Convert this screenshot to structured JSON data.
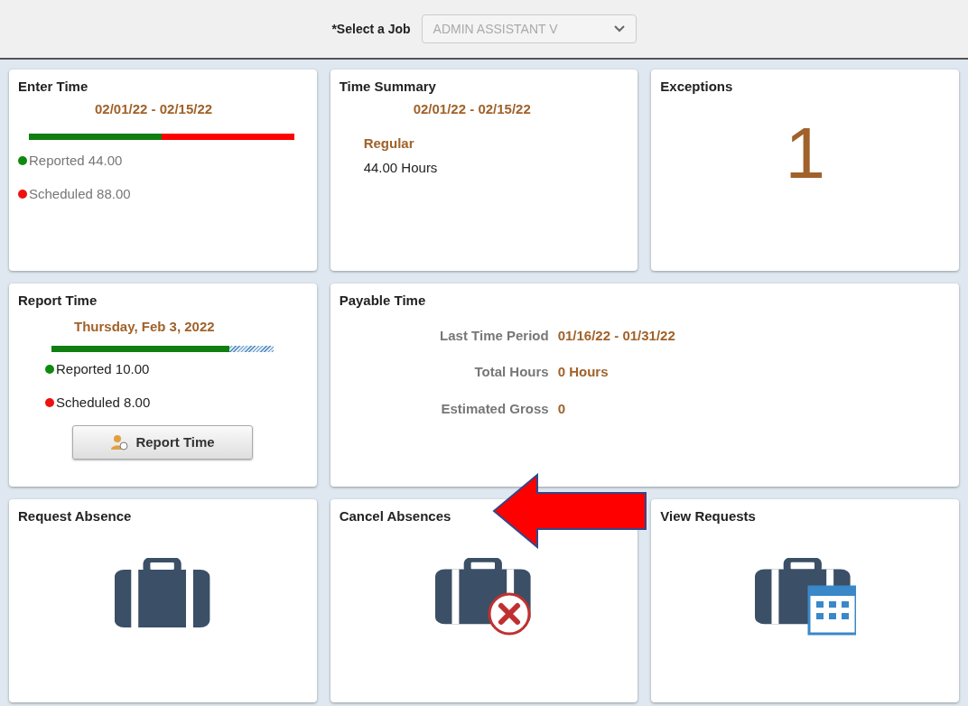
{
  "header": {
    "job_label": "*Select a Job",
    "job_select": {
      "value": "ADMIN ASSISTANT V",
      "disabled": true
    }
  },
  "tiles": [
    {
      "kind": "enter_time",
      "title": "Enter Time",
      "period": "02/01/22 - 02/15/22",
      "level": 0.5,
      "legend": [
        {
          "label": "Reported 44.00",
          "color": "#0f8a0f"
        },
        {
          "label": "Scheduled 88.00",
          "color": "#ee1111"
        }
      ]
    },
    {
      "kind": "summary",
      "title": "Time Summary",
      "period": "02/01/22 - 02/15/22",
      "category": "Regular",
      "hours": "44.00 Hours"
    },
    {
      "kind": "exceptions",
      "title": "Exceptions",
      "count": "1"
    },
    {
      "kind": "report_time",
      "title": "Report Time",
      "date": "Thursday, Feb 3, 2022",
      "level": 0.8,
      "legend": [
        {
          "label": "Reported 10.00",
          "color": "#0f8a0f"
        },
        {
          "label": "Scheduled 8.00",
          "color": "#ee1111"
        }
      ],
      "button": "Report Time"
    },
    {
      "kind": "payable",
      "title": "Payable Time",
      "rows": [
        {
          "label": "Last Time Period",
          "value": "01/16/22 - 01/31/22"
        },
        {
          "label": "Total Hours",
          "value": "0 Hours"
        },
        {
          "label": "Estimated Gross",
          "value": "0"
        }
      ]
    },
    {
      "kind": "request_absence",
      "title": "Request Absence"
    },
    {
      "kind": "cancel_absence",
      "title": "Cancel Absences"
    },
    {
      "kind": "view_requests",
      "title": "View Requests"
    }
  ]
}
